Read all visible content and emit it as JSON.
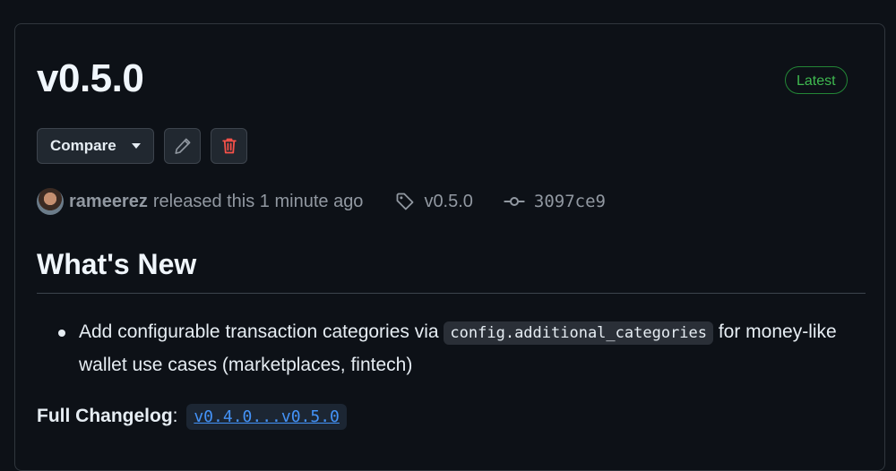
{
  "release": {
    "title": "v0.5.0",
    "badge": "Latest",
    "badge_color": "#3fb950"
  },
  "actions": {
    "compare_label": "Compare",
    "edit_icon": "pencil-icon",
    "delete_icon": "trash-icon",
    "delete_color": "#f85149"
  },
  "meta": {
    "username": "rameerez",
    "released_text": "released this 1 minute ago",
    "tag": "v0.5.0",
    "commit": "3097ce9"
  },
  "notes": {
    "heading": "What's New",
    "items": [
      {
        "before": "Add configurable transaction categories via ",
        "code": "config.additional_categories",
        "after": " for money-like wallet use cases (marketplaces, fintech)"
      }
    ],
    "changelog_label": "Full Changelog",
    "changelog_sep": ":",
    "changelog_link": "v0.4.0...v0.5.0"
  }
}
